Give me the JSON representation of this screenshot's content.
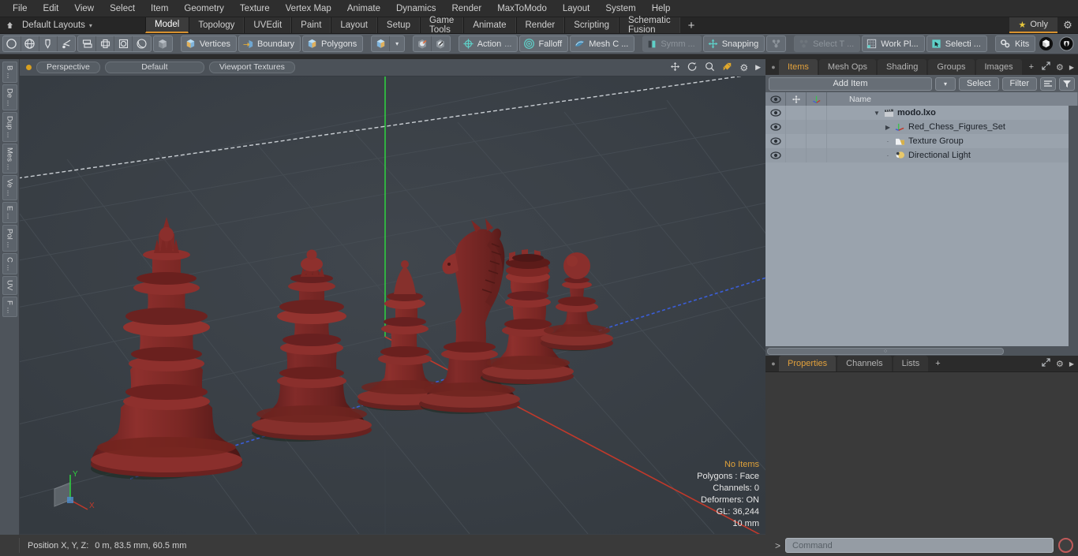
{
  "menubar": {
    "items": [
      "File",
      "Edit",
      "View",
      "Select",
      "Item",
      "Geometry",
      "Texture",
      "Vertex Map",
      "Animate",
      "Dynamics",
      "Render",
      "MaxToModo",
      "Layout",
      "System",
      "Help"
    ]
  },
  "layoutbar": {
    "home_icon": "home-icon",
    "default_layouts": "Default Layouts",
    "caret": "▾",
    "tabs": [
      "Model",
      "Topology",
      "UVEdit",
      "Paint",
      "Layout",
      "Setup",
      "Game Tools",
      "Animate",
      "Render",
      "Scripting",
      "Schematic Fusion"
    ],
    "active_tab": "Model",
    "plus": "+",
    "only_label": "Only",
    "star_icon": "star-icon",
    "gear_icon": "gear-icon"
  },
  "toolbar": {
    "shape_icons": [
      "circle-icon",
      "globe-icon",
      "pen-icon",
      "lasso-icon"
    ],
    "arrange_icons": [
      "align-icon",
      "center-icon",
      "square-round-icon",
      "ellipse-icon"
    ],
    "cube_icon": "cube-icon",
    "selection_modes": [
      {
        "label": "Vertices",
        "icon": "vertices-cube-icon"
      },
      {
        "label": "Boundary",
        "icon": "boundary-cube-icon"
      },
      {
        "label": "Polygons",
        "icon": "polygons-cube-icon"
      }
    ],
    "mode_dropdown_icon": "cube-dropdown-icon",
    "mode_caret": "▾",
    "sphere_icons": [
      "sphere-handle-icon",
      "sphere-arrow-icon"
    ],
    "tools": [
      {
        "label": "Action",
        "suffix": "...",
        "icon": "action-center-icon"
      },
      {
        "label": "Falloff",
        "suffix": "",
        "icon": "falloff-icon"
      },
      {
        "label": "Mesh C ...",
        "suffix": "",
        "icon": "mesh-constraint-icon"
      }
    ],
    "symmetry": {
      "label": "Symm ...",
      "icon": "symmetry-icon"
    },
    "snapping": {
      "label": "Snapping",
      "icon": "snapping-icon"
    },
    "snap_extra_icon": "snap-nodes-icon",
    "select_through": {
      "label": "Select T ...",
      "icon": "select-through-icon"
    },
    "work_plane": {
      "label": "Work Pl...",
      "icon": "work-plane-icon"
    },
    "selection_set": {
      "label": "Selecti ...",
      "icon": "selection-set-icon"
    },
    "kits": {
      "label": "Kits",
      "icon": "kits-gears-icon"
    },
    "right_icons": [
      "modo-ball-icon",
      "unreal-icon"
    ]
  },
  "vertical_tabs": [
    "B ...",
    "De ...",
    "Dup ...",
    "Mes ...",
    "Ve ...",
    "E ...",
    "Pol ...",
    "C ...",
    "UV",
    "F ..."
  ],
  "viewport": {
    "header": {
      "dot_color": "#d8a020",
      "view_mode": "Perspective",
      "preset": "Default",
      "shading": "Viewport Textures",
      "icons": [
        "pan-icon",
        "rotate-icon",
        "zoom-icon",
        "maximize-icon",
        "gear-icon",
        "play-arrow-icon"
      ]
    },
    "background_color": "#3a4046",
    "model_color": "#7d2a28",
    "grid_color": "#464d54",
    "axis_x_color": "#c0392b",
    "axis_y_color": "#2ecc40",
    "axis_z_color": "#3b5ed8",
    "stats": {
      "selection": "No Items",
      "polygons": "Polygons : Face",
      "channels": "Channels: 0",
      "deformers": "Deformers: ON",
      "gl": "GL: 36,244",
      "scale": "10 mm"
    },
    "gizmo": {
      "x_label": "X",
      "y_label": "Y"
    },
    "pieces": [
      "king",
      "queen",
      "bishop",
      "knight",
      "rook",
      "pawn"
    ]
  },
  "item_panel": {
    "tabs": [
      "Items",
      "Mesh Ops",
      "Shading",
      "Groups",
      "Images"
    ],
    "active_tab": "Items",
    "plus": "+",
    "right_icons": [
      "expand-icon",
      "gear-icon",
      "play-arrow-icon"
    ],
    "add_item": "Add Item",
    "add_caret": "▾",
    "select_btn": "Select",
    "filter_btn": "Filter",
    "list_icon": "list-options-icon",
    "funnel_icon": "funnel-icon",
    "columns": {
      "eye": "eye-icon",
      "move": "move-icon",
      "axis": "axis-icon",
      "name": "Name"
    },
    "rows": [
      {
        "name": "modo.lxo",
        "icon": "scene-clapper-icon",
        "depth": 0,
        "twisty": "▼",
        "bold": true
      },
      {
        "name": "Red_Chess_Figures_Set",
        "icon": "mesh-axis-icon",
        "depth": 1,
        "twisty": "▶",
        "bold": false
      },
      {
        "name": "Texture Group",
        "icon": "folder-texture-icon",
        "depth": 1,
        "twisty": "",
        "bold": false
      },
      {
        "name": "Directional Light",
        "icon": "light-icon",
        "depth": 1,
        "twisty": "",
        "bold": false
      }
    ]
  },
  "properties_panel": {
    "tabs": [
      "Properties",
      "Channels",
      "Lists"
    ],
    "active_tab": "Properties",
    "plus": "+",
    "right_icons": [
      "expand-icon",
      "gear-icon",
      "play-arrow-icon"
    ]
  },
  "statusbar": {
    "position_label": "Position X, Y, Z:",
    "position_value": "0 m, 83.5 mm, 60.5 mm",
    "command_prompt": ">",
    "command_placeholder": "Command",
    "record_icon": "record-circle-icon"
  }
}
